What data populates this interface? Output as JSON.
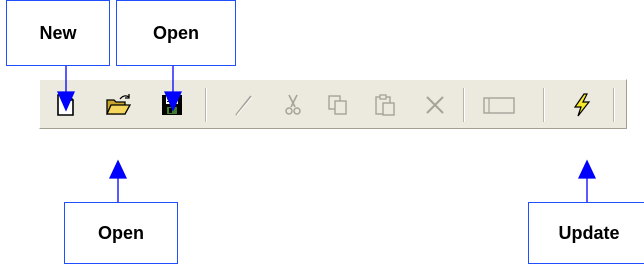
{
  "callouts": {
    "new": "New",
    "open_top": "Open",
    "open_bottom": "Open",
    "update": "Update"
  },
  "toolbar": {
    "buttons": [
      {
        "icon": "new-document-icon",
        "enabled": true
      },
      {
        "icon": "open-folder-icon",
        "enabled": true
      },
      {
        "icon": "save-disk-icon",
        "enabled": true
      },
      {
        "icon": "pen-icon",
        "enabled": false
      },
      {
        "icon": "cut-icon",
        "enabled": false
      },
      {
        "icon": "copy-icon",
        "enabled": false
      },
      {
        "icon": "paste-icon",
        "enabled": false
      },
      {
        "icon": "delete-icon",
        "enabled": false
      },
      {
        "icon": "rectangle-icon",
        "enabled": false
      },
      {
        "icon": "lightning-update-icon",
        "enabled": true
      }
    ]
  },
  "colors": {
    "callout_border": "#1f4fff",
    "arrow": "#0000ff",
    "toolbar_bg": "#eceadf"
  }
}
